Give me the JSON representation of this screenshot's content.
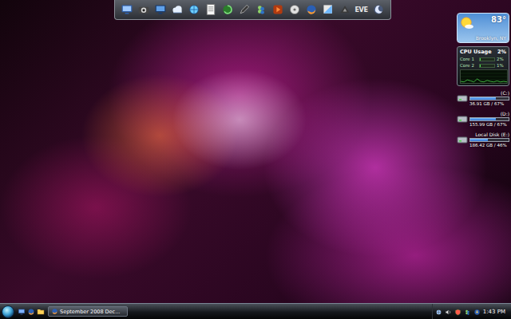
{
  "dock": {
    "items": [
      {
        "kind": "computer"
      },
      {
        "kind": "camera"
      },
      {
        "kind": "monitor"
      },
      {
        "kind": "cloud"
      },
      {
        "kind": "globe"
      },
      {
        "kind": "notepad"
      },
      {
        "kind": "swirl"
      },
      {
        "kind": "pen"
      },
      {
        "kind": "messenger"
      },
      {
        "kind": "media"
      },
      {
        "kind": "disc"
      },
      {
        "kind": "firefox"
      },
      {
        "kind": "stack"
      },
      {
        "kind": "game"
      },
      {
        "kind": "text-logo",
        "label": "EVE"
      },
      {
        "kind": "moon"
      }
    ]
  },
  "weather": {
    "temperature": "83°",
    "location": "Brooklyn, NY"
  },
  "cpu": {
    "title": "CPU Usage",
    "usage": "2%",
    "cores": [
      {
        "label": "Core 1",
        "value": "2%",
        "level": 0.02
      },
      {
        "label": "Core 2",
        "value": "1%",
        "level": 0.01
      }
    ],
    "history": [
      3,
      2,
      6,
      4,
      2,
      8,
      3,
      2,
      5,
      3,
      2,
      4,
      2,
      3,
      2
    ]
  },
  "drives": [
    {
      "label": "(C:)",
      "reading": "36.91 GB / 67%",
      "level": 0.67
    },
    {
      "label": "(D:)",
      "reading": "155.99 GB / 67%",
      "level": 0.67
    },
    {
      "label": "Local Disk (E:)",
      "reading": "186.42 GB / 46%",
      "level": 0.46
    }
  ],
  "taskbar": {
    "quick_launch": [
      {
        "kind": "desktop"
      },
      {
        "kind": "firefox"
      },
      {
        "kind": "explorer"
      }
    ],
    "tasks": [
      {
        "label": "September 2008 Dec...",
        "selected": false
      }
    ],
    "tray": [
      {
        "kind": "network"
      },
      {
        "kind": "volume"
      },
      {
        "kind": "shield"
      },
      {
        "kind": "messenger"
      },
      {
        "kind": "update"
      }
    ],
    "clock": "1:43 PM"
  }
}
